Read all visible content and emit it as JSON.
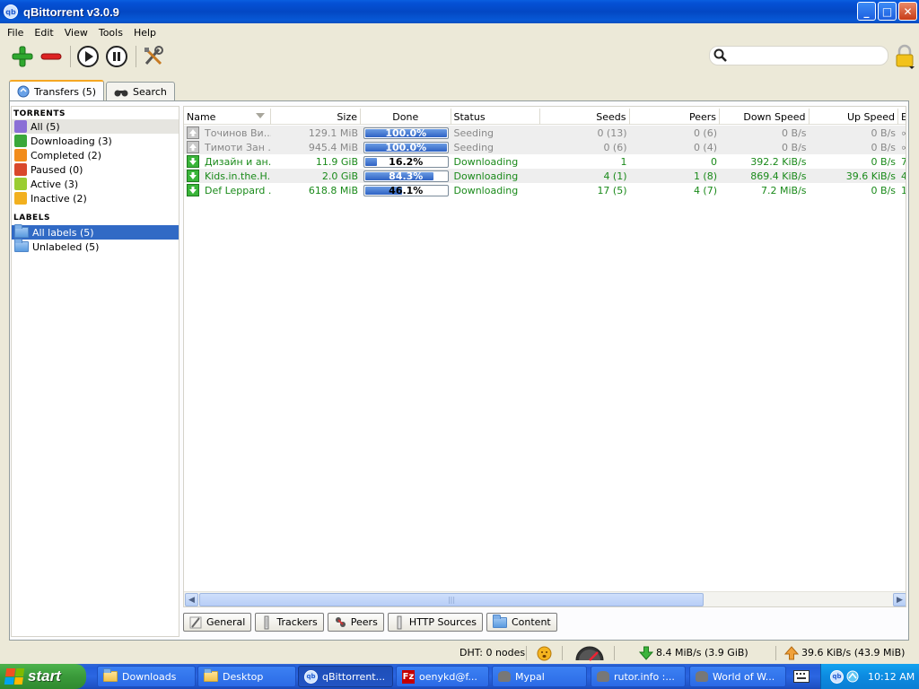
{
  "window": {
    "title": "qBittorrent v3.0.9",
    "buttons": {
      "minimize": "_",
      "maximize": "□",
      "close": "✕"
    }
  },
  "menubar": [
    "File",
    "Edit",
    "View",
    "Tools",
    "Help"
  ],
  "search": {
    "placeholder": ""
  },
  "tabs": [
    {
      "label": "Transfers (5)",
      "icon": "transfers-icon"
    },
    {
      "label": "Search",
      "icon": "binoculars-icon"
    }
  ],
  "sidebar": {
    "torrents_header": "TORRENTS",
    "torrents": [
      {
        "label": "All (5)",
        "icon": "all-icon",
        "color": "#8b6fd6"
      },
      {
        "label": "Downloading (3)",
        "icon": "downloading-icon",
        "color": "#3aa83a"
      },
      {
        "label": "Completed (2)",
        "icon": "completed-icon",
        "color": "#f28c1a"
      },
      {
        "label": "Paused (0)",
        "icon": "paused-icon",
        "color": "#d9482b"
      },
      {
        "label": "Active (3)",
        "icon": "active-icon",
        "color": "#9acd32"
      },
      {
        "label": "Inactive (2)",
        "icon": "inactive-icon",
        "color": "#f2b01e"
      }
    ],
    "labels_header": "LABELS",
    "labels": [
      {
        "label": "All labels (5)",
        "icon": "folder-icon"
      },
      {
        "label": "Unlabeled (5)",
        "icon": "folder-icon"
      }
    ]
  },
  "columns": [
    "Name",
    "Size",
    "Done",
    "Status",
    "Seeds",
    "Peers",
    "Down Speed",
    "Up Speed",
    "E"
  ],
  "torrents": [
    {
      "name": "Точинов Ви...",
      "size": "129.1 MiB",
      "done": 1.0,
      "done_label": "100.0%",
      "status": "Seeding",
      "seeds": "0 (13)",
      "peers": "0 (6)",
      "down": "0 B/s",
      "up": "0 B/s",
      "eta": "∞"
    },
    {
      "name": "Тимоти Зан ...",
      "size": "945.4 MiB",
      "done": 1.0,
      "done_label": "100.0%",
      "status": "Seeding",
      "seeds": "0 (6)",
      "peers": "0 (4)",
      "down": "0 B/s",
      "up": "0 B/s",
      "eta": "∞"
    },
    {
      "name": "Дизайн и ан...",
      "size": "11.9 GiB",
      "done": 0.162,
      "done_label": "16.2%",
      "status": "Downloading",
      "seeds": "1",
      "peers": "0",
      "down": "392.2 KiB/s",
      "up": "0 B/s",
      "eta": "7"
    },
    {
      "name": "Kids.in.the.H...",
      "size": "2.0 GiB",
      "done": 0.843,
      "done_label": "84.3%",
      "status": "Downloading",
      "seeds": "4 (1)",
      "peers": "1 (8)",
      "down": "869.4 KiB/s",
      "up": "39.6 KiB/s",
      "eta": "4"
    },
    {
      "name": "Def Leppard ...",
      "size": "618.8 MiB",
      "done": 0.461,
      "done_label": "46.1%",
      "status": "Downloading",
      "seeds": "17 (5)",
      "peers": "4 (7)",
      "down": "7.2 MiB/s",
      "up": "0 B/s",
      "eta": "1"
    }
  ],
  "bottom_tabs": [
    {
      "label": "General",
      "icon": "general-icon"
    },
    {
      "label": "Trackers",
      "icon": "trackers-icon"
    },
    {
      "label": "Peers",
      "icon": "peers-icon"
    },
    {
      "label": "HTTP Sources",
      "icon": "http-sources-icon"
    },
    {
      "label": "Content",
      "icon": "content-folder-icon"
    }
  ],
  "status": {
    "dht": "DHT: 0 nodes",
    "down": "8.4 MiB/s (3.9 GiB)",
    "up": "39.6 KiB/s (43.9 MiB)"
  },
  "taskbar": {
    "start": "start",
    "tasks": [
      {
        "label": "Downloads",
        "icon": "folder-icon"
      },
      {
        "label": "Desktop",
        "icon": "folder-icon"
      },
      {
        "label": "qBittorrent...",
        "icon": "qbittorrent-icon"
      },
      {
        "label": "oenykd@f...",
        "icon": "filezilla-icon"
      },
      {
        "label": "Mypal",
        "icon": "mypal-icon"
      },
      {
        "label": "rutor.info :...",
        "icon": "browser-icon"
      },
      {
        "label": "World of W...",
        "icon": "browser-icon"
      }
    ],
    "clock": "10:12 AM"
  }
}
